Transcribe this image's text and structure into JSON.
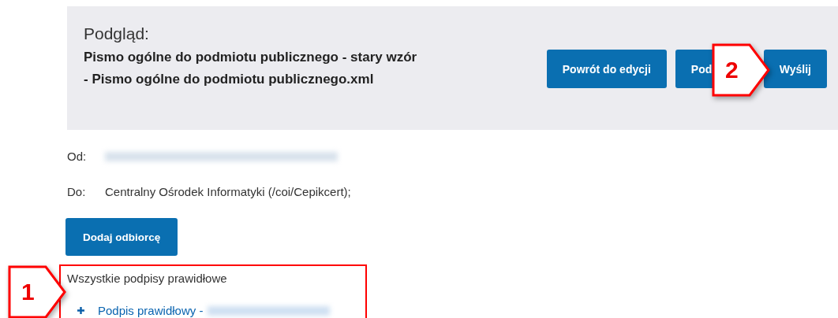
{
  "preview": {
    "heading": "Podgląd:",
    "document_title": "Pismo ogólne do podmiotu publicznego - stary wzór - Pismo ogólne do podmiotu publicznego.xml",
    "buttons": [
      {
        "label": "Powrót do edycji"
      },
      {
        "label": "Pod"
      },
      {
        "label": "Wyślij"
      }
    ]
  },
  "fields": [
    {
      "label": "Od:",
      "redacted": true
    },
    {
      "label": "Do:",
      "value": "Centralny Ośrodek Informatyki (/coi/Cepikcert);",
      "redacted": false
    }
  ],
  "add_recipient_button": "Dodaj odbiorcę",
  "signatures": {
    "summary": "Wszystkie podpisy prawidłowe",
    "items": [
      {
        "label": "Podpis prawidłowy -",
        "signer_redacted": true
      }
    ]
  },
  "callouts": [
    {
      "label": "1"
    },
    {
      "label": "2"
    }
  ]
}
